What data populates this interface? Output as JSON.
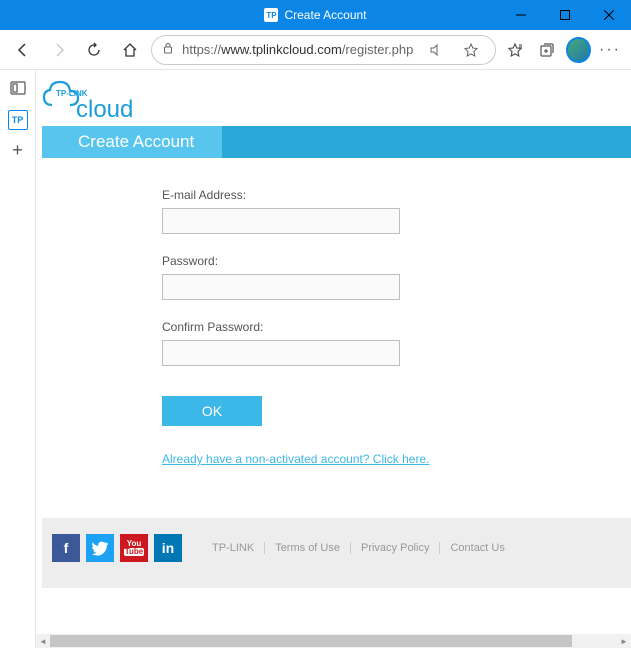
{
  "window": {
    "tab_title": "Create Account",
    "url_prefix": "https://",
    "url_host": "www.tplinkcloud.com",
    "url_path": "/register.php"
  },
  "logo": {
    "line1": "TP-LINK",
    "line2": "cloud"
  },
  "banner": {
    "title": "Create Account"
  },
  "form": {
    "email_label": "E-mail Address:",
    "email_value": "",
    "password_label": "Password:",
    "password_value": "",
    "confirm_label": "Confirm Password:",
    "confirm_value": "",
    "ok_label": "OK",
    "activate_link": "Already have a non-activated account? Click here."
  },
  "footer": {
    "links": [
      "TP-LINK",
      "Terms of Use",
      "Privacy Policy",
      "Contact Us"
    ]
  }
}
